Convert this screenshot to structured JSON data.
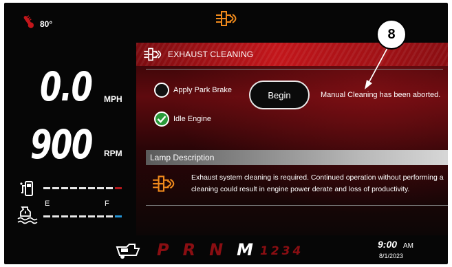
{
  "status_bar": {
    "temperature": "80°",
    "icons": [
      "temperature-icon",
      "exhaust-cleaning-icon"
    ]
  },
  "gauges": {
    "speed": "0.0",
    "speed_unit": "MPH",
    "rpm": "900",
    "rpm_unit": "RPM",
    "fuel_icon": "fuel-pump-icon",
    "def_icon": "def-fluid-icon",
    "def_empty_label": "E",
    "def_full_label": "F"
  },
  "panel": {
    "title": "EXHAUST CLEANING",
    "steps": [
      {
        "label": "Apply Park Brake",
        "state": "unchecked"
      },
      {
        "label": "Idle Engine",
        "state": "checked"
      }
    ],
    "begin_label": "Begin",
    "status_message": "Manual Cleaning has been aborted.",
    "callout_number": "8"
  },
  "lamp": {
    "title": "Lamp Description",
    "description": "Exhaust system cleaning is required. Continued operation without performing a cleaning could result in engine power derate and loss of productivity."
  },
  "bottom_bar": {
    "gears": [
      "P",
      "R",
      "N",
      "M"
    ],
    "active_gear": "M",
    "gear_numbers": "1234",
    "time": "9:00",
    "ampm": "AM",
    "date": "8/1/2023"
  },
  "colors": {
    "accent_red": "#c3161b",
    "dim_red": "#8a0e12",
    "icon_orange": "#f08a1c",
    "check_green": "#2a9a3a",
    "def_blue": "#2596d8"
  }
}
